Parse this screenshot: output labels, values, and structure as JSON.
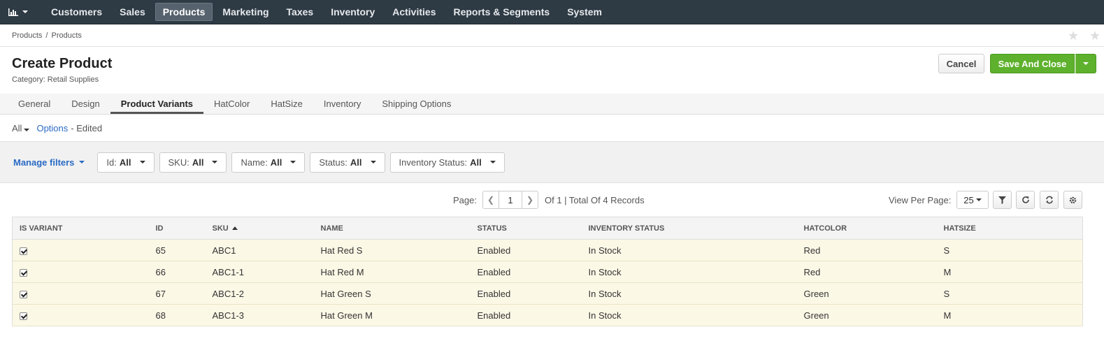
{
  "nav": {
    "brand_icon": "bar-chart-icon",
    "items": [
      "Customers",
      "Sales",
      "Products",
      "Marketing",
      "Taxes",
      "Inventory",
      "Activities",
      "Reports & Segments",
      "System"
    ],
    "active": "Products"
  },
  "breadcrumb": [
    "Products",
    "Products"
  ],
  "page": {
    "title": "Create Product",
    "category": "Category: Retail Supplies",
    "cancel_label": "Cancel",
    "save_label": "Save And Close"
  },
  "tabs": [
    "General",
    "Design",
    "Product Variants",
    "HatColor",
    "HatSize",
    "Inventory",
    "Shipping Options"
  ],
  "active_tab": "Product Variants",
  "view": {
    "all_label": "All",
    "options_label": "Options",
    "edited_label": "- Edited"
  },
  "filters": {
    "manage_label": "Manage filters",
    "items": [
      {
        "name": "Id:",
        "value": "All"
      },
      {
        "name": "SKU:",
        "value": "All"
      },
      {
        "name": "Name:",
        "value": "All"
      },
      {
        "name": "Status:",
        "value": "All"
      },
      {
        "name": "Inventory Status:",
        "value": "All"
      }
    ]
  },
  "pager": {
    "page_label": "Page:",
    "page": "1",
    "total": "Of 1 | Total Of 4 Records",
    "per_page_label": "View Per Page:",
    "per_page": "25"
  },
  "table": {
    "columns": [
      "IS VARIANT",
      "ID",
      "SKU",
      "NAME",
      "STATUS",
      "INVENTORY STATUS",
      "HATCOLOR",
      "HATSIZE"
    ],
    "rows": [
      {
        "checked": true,
        "id": "65",
        "sku": "ABC1",
        "name": "Hat Red S",
        "status": "Enabled",
        "inventory": "In Stock",
        "color": "Red",
        "size": "S"
      },
      {
        "checked": true,
        "id": "66",
        "sku": "ABC1-1",
        "name": "Hat Red M",
        "status": "Enabled",
        "inventory": "In Stock",
        "color": "Red",
        "size": "M"
      },
      {
        "checked": true,
        "id": "67",
        "sku": "ABC1-2",
        "name": "Hat Green S",
        "status": "Enabled",
        "inventory": "In Stock",
        "color": "Green",
        "size": "S"
      },
      {
        "checked": true,
        "id": "68",
        "sku": "ABC1-3",
        "name": "Hat Green M",
        "status": "Enabled",
        "inventory": "In Stock",
        "color": "Green",
        "size": "M"
      }
    ]
  },
  "colors": {
    "nav_bg": "#2e3a44",
    "save_green": "#5eb12c",
    "link_blue": "#2a6ac4",
    "row_bg": "#fcf8e6"
  }
}
